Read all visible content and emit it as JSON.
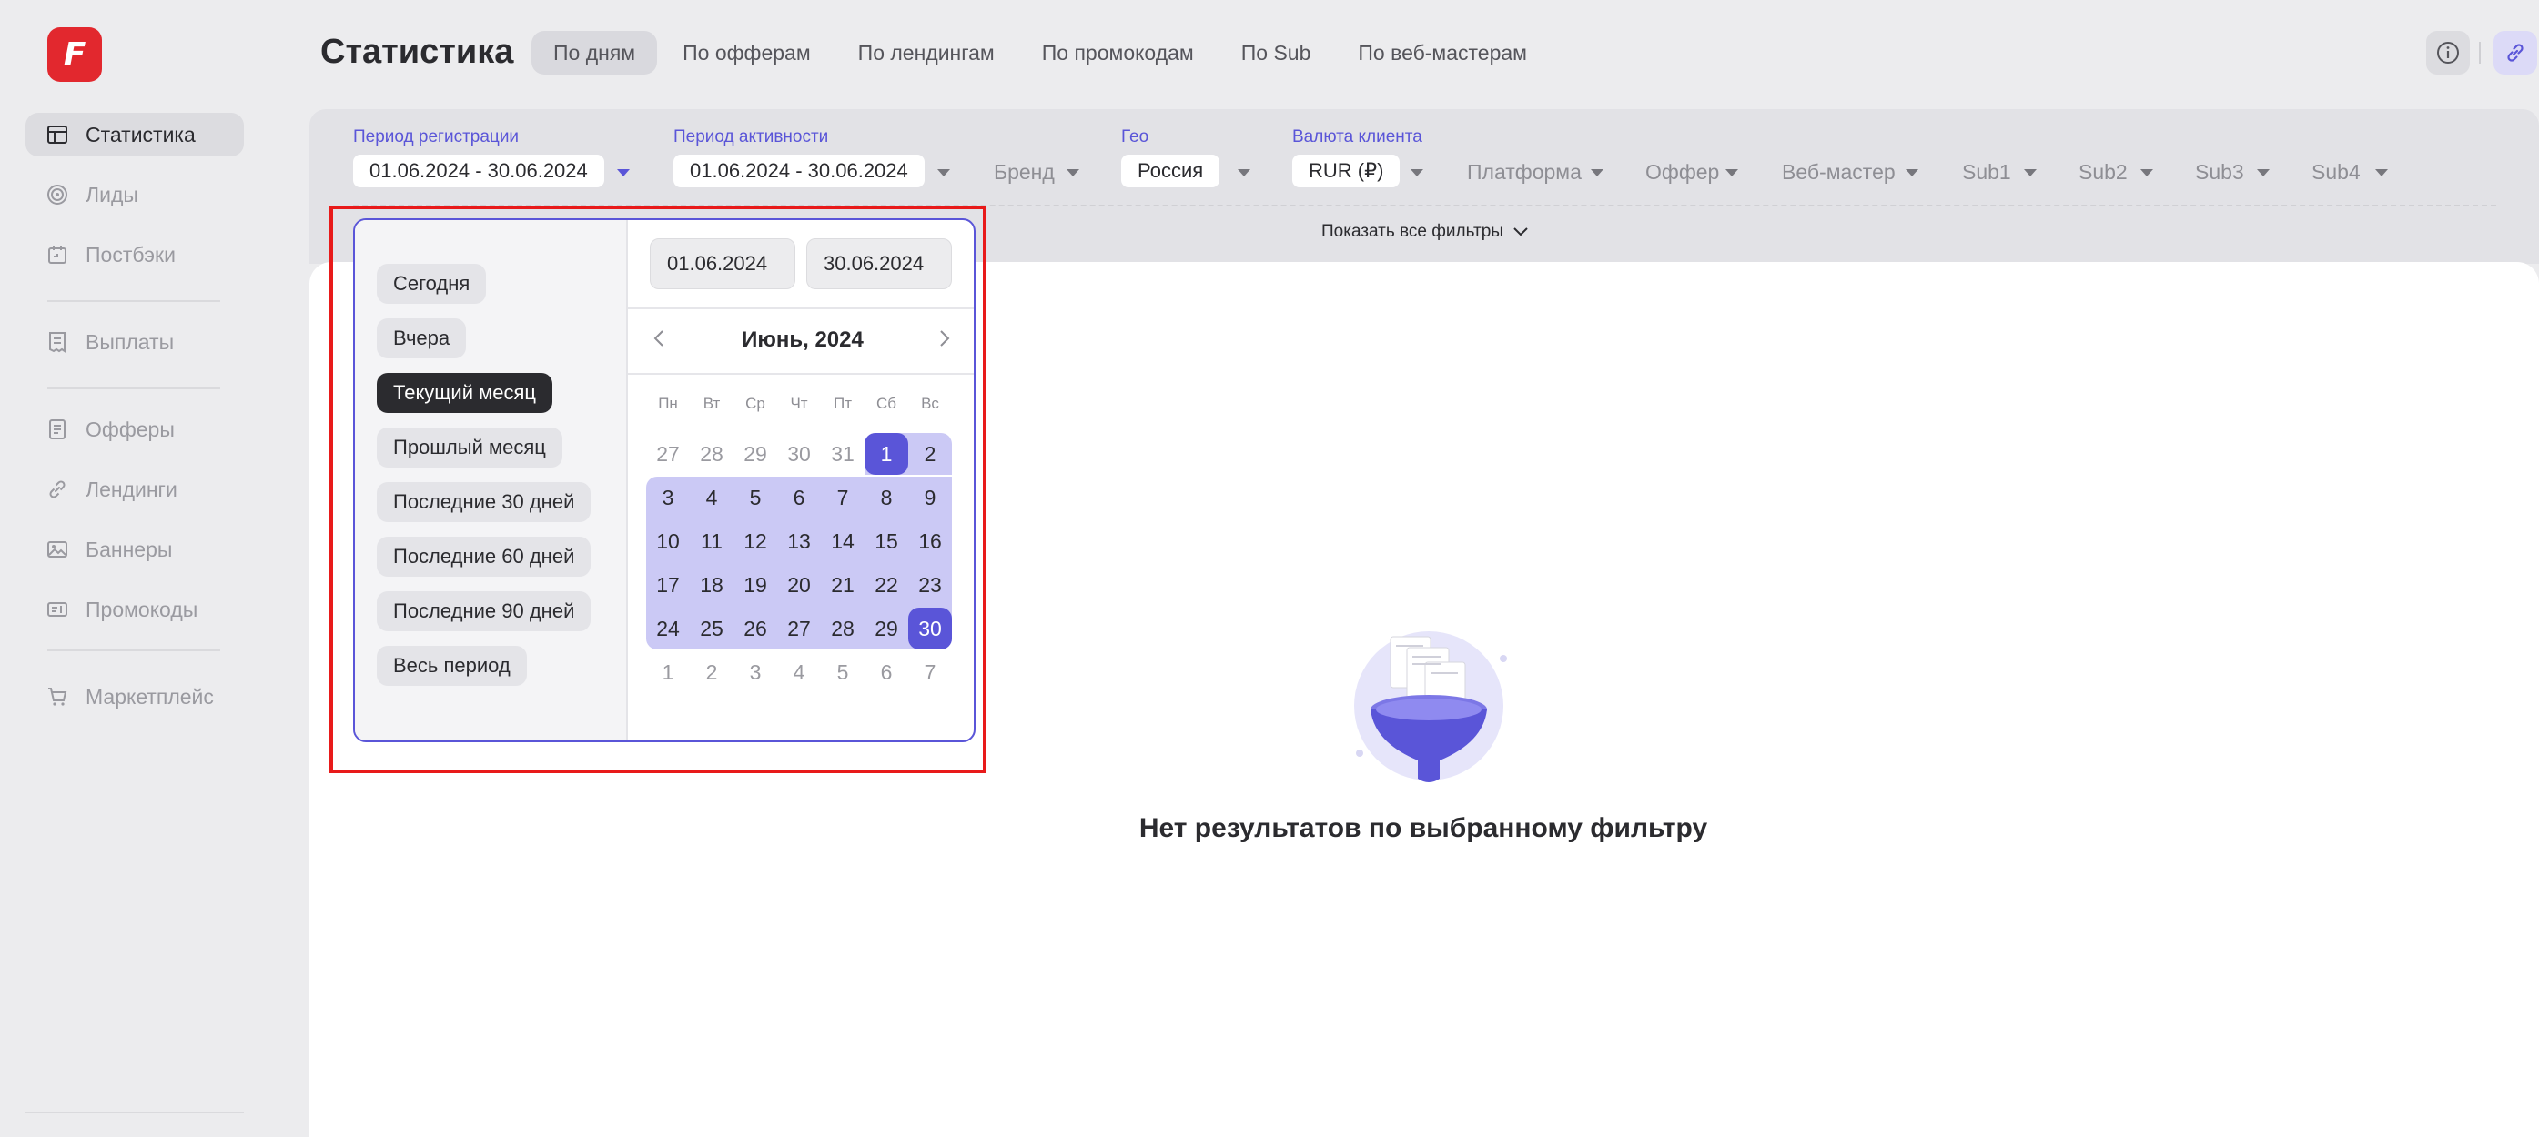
{
  "brand": {
    "logo_letter": "F"
  },
  "sidebar": {
    "items": [
      {
        "label": "Статистика",
        "icon": "table-icon",
        "active": true
      },
      {
        "label": "Лиды",
        "icon": "target-icon"
      },
      {
        "label": "Постбэки",
        "icon": "postback-icon"
      },
      {
        "label": "Выплаты",
        "icon": "receipt-icon"
      },
      {
        "label": "Офферы",
        "icon": "document-icon"
      },
      {
        "label": "Лендинги",
        "icon": "link-icon"
      },
      {
        "label": "Баннеры",
        "icon": "image-icon"
      },
      {
        "label": "Промокоды",
        "icon": "promo-icon"
      },
      {
        "label": "Маркетплейс",
        "icon": "cart-icon"
      }
    ]
  },
  "header": {
    "title": "Статистика",
    "tabs": [
      {
        "label": "По дням",
        "active": true
      },
      {
        "label": "По офферам"
      },
      {
        "label": "По лендингам"
      },
      {
        "label": "По промокодам"
      },
      {
        "label": "По Sub"
      },
      {
        "label": "По веб-мастерам"
      }
    ]
  },
  "filters": {
    "reg_period": {
      "label": "Период регистрации",
      "value": "01.06.2024 - 30.06.2024"
    },
    "activity_period": {
      "label": "Период активности",
      "value": "01.06.2024 - 30.06.2024"
    },
    "brand": "Бренд",
    "geo": {
      "label": "Гео",
      "value": "Россия"
    },
    "currency": {
      "label": "Валюта клиента",
      "value": "RUR (₽)"
    },
    "platform": "Платформа",
    "offer": "Оффер",
    "webmaster": "Веб-мастер",
    "sub1": "Sub1",
    "sub2": "Sub2",
    "sub3": "Sub3",
    "sub4": "Sub4",
    "show_all": "Показать все фильтры"
  },
  "datepicker": {
    "presets": [
      {
        "label": "Сегодня"
      },
      {
        "label": "Вчера"
      },
      {
        "label": "Текущий месяц",
        "active": true
      },
      {
        "label": "Прошлый месяц"
      },
      {
        "label": "Последние 30 дней"
      },
      {
        "label": "Последние 60 дней"
      },
      {
        "label": "Последние 90 дней"
      },
      {
        "label": "Весь период"
      }
    ],
    "from": "01.06.2024",
    "to": "30.06.2024",
    "month_title": "Июнь, 2024",
    "weekdays": [
      "Пн",
      "Вт",
      "Ср",
      "Чт",
      "Пт",
      "Сб",
      "Вс"
    ],
    "weeks": [
      [
        "27",
        "28",
        "29",
        "30",
        "31",
        "1",
        "2"
      ],
      [
        "3",
        "4",
        "5",
        "6",
        "7",
        "8",
        "9"
      ],
      [
        "10",
        "11",
        "12",
        "13",
        "14",
        "15",
        "16"
      ],
      [
        "17",
        "18",
        "19",
        "20",
        "21",
        "22",
        "23"
      ],
      [
        "24",
        "25",
        "26",
        "27",
        "28",
        "29",
        "30"
      ],
      [
        "1",
        "2",
        "3",
        "4",
        "5",
        "6",
        "7"
      ]
    ],
    "range_start_day": "1",
    "range_end_day": "30"
  },
  "empty_state": {
    "text": "Нет результатов по выбранному фильтру"
  },
  "colors": {
    "accent": "#5a55d8",
    "range": "#cbc9f5",
    "brand": "#e2282e",
    "highlight_border": "#e81a1a"
  }
}
